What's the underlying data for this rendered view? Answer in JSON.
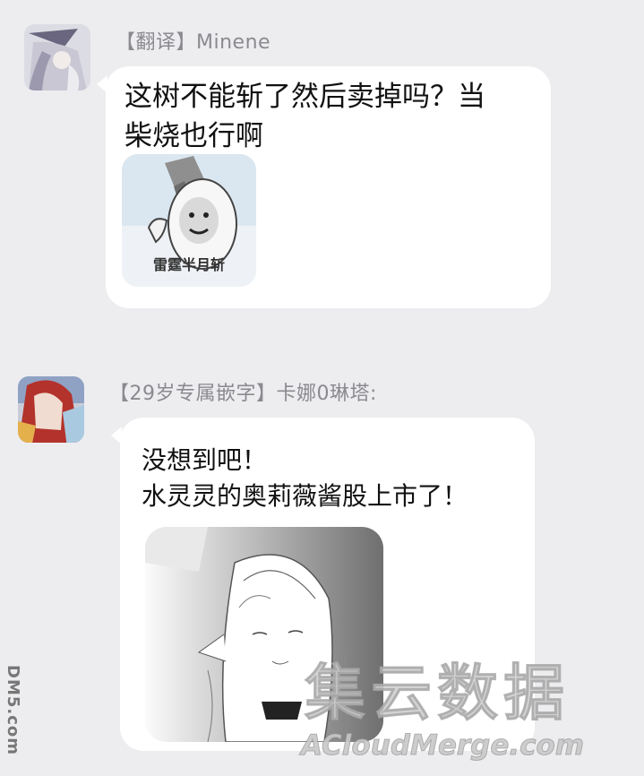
{
  "messages": [
    {
      "sender": "【翻译】Minene",
      "text": "这树不能斩了然后卖掉吗？当\n柴烧也行啊",
      "sticker_caption": "雷霆半月斩"
    },
    {
      "sender": "【29岁专属嵌字】卡娜0琳塔:",
      "text": "没想到吧！\n水灵灵的奥莉薇酱股上市了！"
    }
  ],
  "watermarks": {
    "side": "DM5.com",
    "chinese": "集云数据",
    "english": "ACloudMerge.com"
  }
}
